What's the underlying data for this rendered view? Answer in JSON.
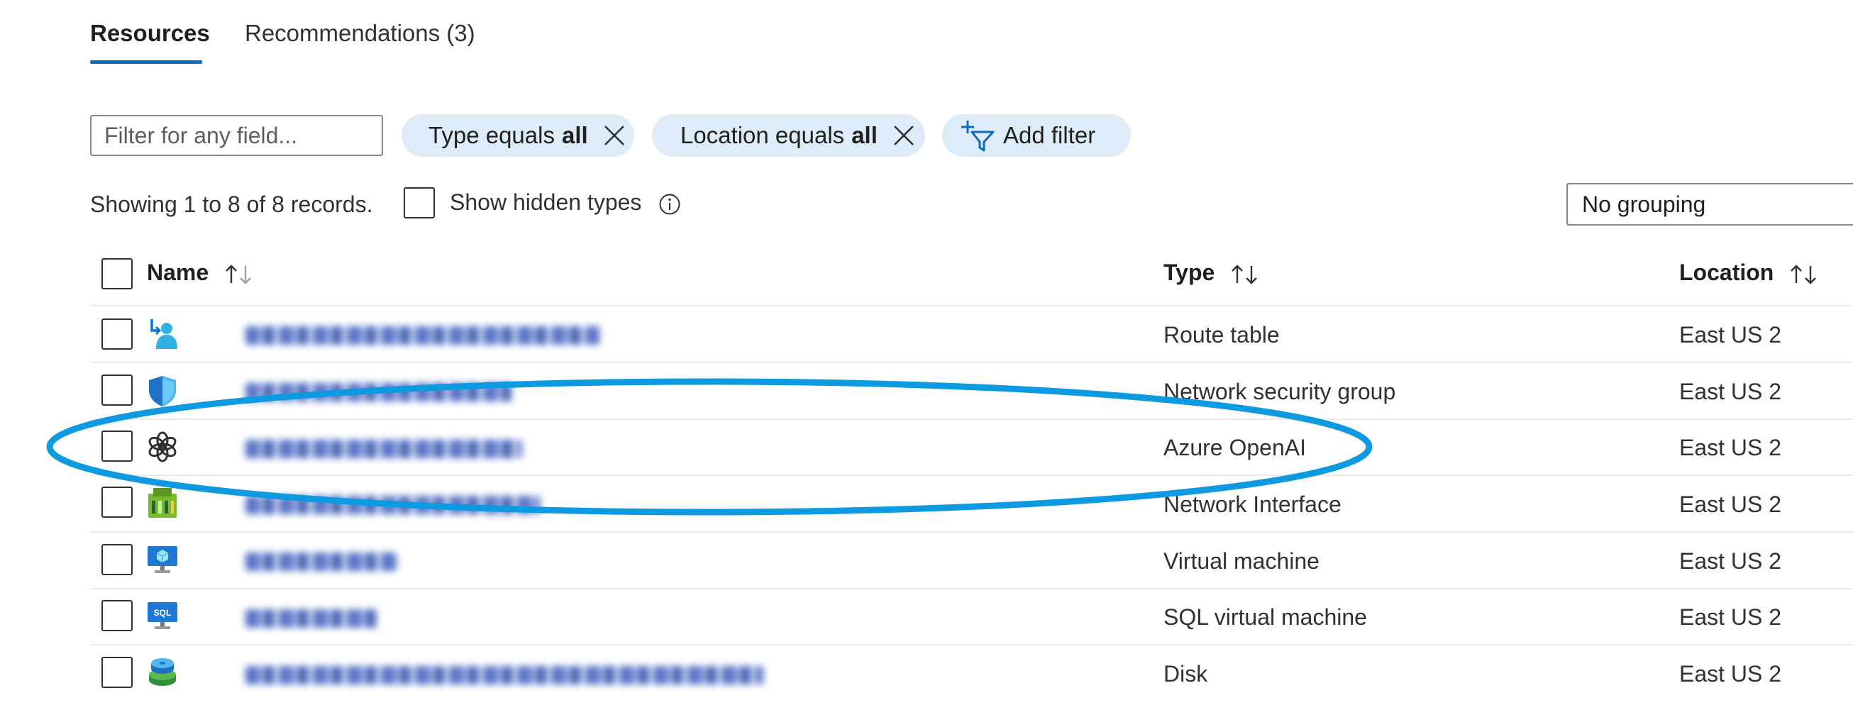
{
  "tabs": [
    {
      "label": "Resources"
    },
    {
      "label": "Recommendations (3)"
    }
  ],
  "filters": {
    "search_placeholder": "Filter for any field...",
    "type_pill": {
      "prefix": "Type equals",
      "value": "all"
    },
    "location_pill": {
      "prefix": "Location equals",
      "value": "all"
    },
    "add_filter_label": "Add filter"
  },
  "records_text": "Showing 1 to 8 of 8 records.",
  "show_hidden_label": "Show hidden types",
  "grouping_value": "No grouping",
  "columns": {
    "name": "Name",
    "type": "Type",
    "location": "Location"
  },
  "rows": [
    {
      "icon": "route-table-icon",
      "type": "Route table",
      "location": "East US 2"
    },
    {
      "icon": "network-security-group-icon",
      "type": "Network security group",
      "location": "East US 2"
    },
    {
      "icon": "azure-openai-icon",
      "type": "Azure OpenAI",
      "location": "East US 2"
    },
    {
      "icon": "network-interface-icon",
      "type": "Network Interface",
      "location": "East US 2"
    },
    {
      "icon": "virtual-machine-icon",
      "type": "Virtual machine",
      "location": "East US 2"
    },
    {
      "icon": "sql-virtual-machine-icon",
      "type": "SQL virtual machine",
      "location": "East US 2"
    },
    {
      "icon": "disk-icon",
      "type": "Disk",
      "location": "East US 2"
    }
  ],
  "sql_icon_text": "SQL",
  "colors": {
    "accent": "#0f6cbd",
    "pill_bg": "#deecf9",
    "annotation": "#0e9ae0"
  }
}
